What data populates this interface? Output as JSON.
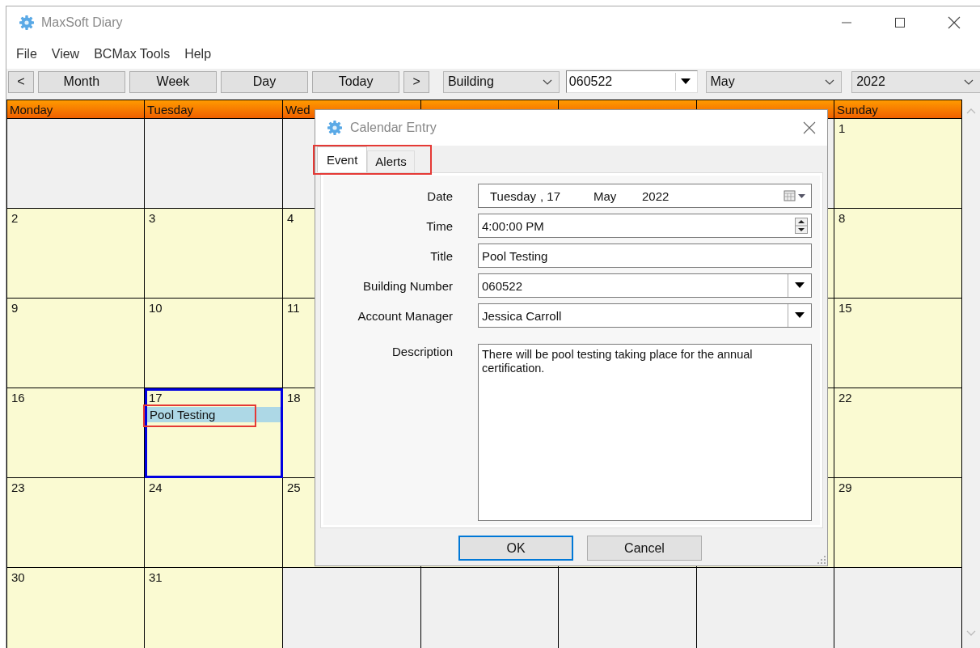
{
  "window": {
    "title": "MaxSoft Diary"
  },
  "menu": [
    "File",
    "View",
    "BCMax Tools",
    "Help"
  ],
  "toolbar": {
    "buttons": [
      {
        "label": "<",
        "kind": "narrow"
      },
      {
        "label": "Month",
        "kind": "wide"
      },
      {
        "label": "Week",
        "kind": "wide"
      },
      {
        "label": "Day",
        "kind": "wide"
      },
      {
        "label": "Today",
        "kind": "wide"
      },
      {
        "label": ">",
        "kind": "narrow"
      }
    ],
    "combos": [
      {
        "value": "Building",
        "kind": "dropdown"
      },
      {
        "value": "060522",
        "kind": "editable"
      },
      {
        "value": "May",
        "kind": "dropdown"
      },
      {
        "value": "2022",
        "kind": "dropdown"
      }
    ]
  },
  "calendar": {
    "columns": [
      {
        "label": "Monday"
      },
      {
        "label": "Tuesday"
      },
      {
        "label": "Wed"
      },
      {
        "label": "Sunday"
      }
    ],
    "weeks": [
      {
        "left": [
          {
            "in_month": false,
            "selected": false
          },
          {
            "in_month": false,
            "selected": false
          },
          {
            "in_month": false,
            "selected": false
          }
        ],
        "right": [
          {
            "in_month": false,
            "selected": false
          },
          {
            "day": "1",
            "in_month": true,
            "selected": false
          }
        ]
      },
      {
        "left": [
          {
            "day": "2",
            "in_month": true,
            "selected": false
          },
          {
            "day": "3",
            "in_month": true,
            "selected": false
          },
          {
            "day": "4",
            "in_month": true,
            "selected": false
          }
        ],
        "right": [
          {
            "in_month": true,
            "selected": false
          },
          {
            "day": "8",
            "in_month": true,
            "selected": false
          }
        ]
      },
      {
        "left": [
          {
            "day": "9",
            "in_month": true,
            "selected": false
          },
          {
            "day": "10",
            "in_month": true,
            "selected": false
          },
          {
            "day": "11",
            "in_month": true,
            "selected": false
          }
        ],
        "right": [
          {
            "in_month": true,
            "selected": false
          },
          {
            "day": "15",
            "in_month": true,
            "selected": false
          }
        ]
      },
      {
        "left": [
          {
            "day": "16",
            "in_month": true,
            "selected": false
          },
          {
            "day": "17",
            "in_month": true,
            "selected": true,
            "events": [
              {
                "title": "Pool Testing",
                "highlighted": true
              }
            ]
          },
          {
            "day": "18",
            "in_month": true,
            "selected": false
          }
        ],
        "right": [
          {
            "in_month": true,
            "selected": false
          },
          {
            "day": "22",
            "in_month": true,
            "selected": false
          }
        ]
      },
      {
        "left": [
          {
            "day": "23",
            "in_month": true,
            "selected": false
          },
          {
            "day": "24",
            "in_month": true,
            "selected": false
          },
          {
            "day": "25",
            "in_month": true,
            "selected": false
          }
        ],
        "right": [
          {
            "in_month": true,
            "selected": false
          },
          {
            "day": "29",
            "in_month": true,
            "selected": false
          }
        ]
      },
      {
        "left": [
          {
            "day": "30",
            "in_month": true,
            "selected": false
          },
          {
            "day": "31",
            "in_month": true,
            "selected": false
          },
          {
            "in_month": false,
            "selected": false
          }
        ],
        "middle": [
          {
            "in_month": false,
            "selected": false
          },
          {
            "in_month": false,
            "selected": false
          }
        ],
        "right": [
          {
            "in_month": false,
            "selected": false
          },
          {
            "in_month": false,
            "selected": false
          }
        ]
      }
    ]
  },
  "dialog": {
    "title": "Calendar Entry",
    "tabs": [
      {
        "label": "Event",
        "selected": true
      },
      {
        "label": "Alerts",
        "selected": false
      }
    ],
    "tabs_highlighted": true,
    "fields": [
      {
        "label": "Date",
        "kind": "date",
        "parts": [
          "Tuesday",
          ", 17",
          "May",
          "2022"
        ]
      },
      {
        "label": "Time",
        "kind": "time",
        "value": "4:00:00 PM"
      },
      {
        "label": "Title",
        "kind": "text",
        "value": "Pool Testing"
      },
      {
        "label": "Building Number",
        "kind": "combo",
        "value": "060522"
      },
      {
        "label": "Account Manager",
        "kind": "combo",
        "value": "Jessica Carroll"
      },
      {
        "label": "Description",
        "kind": "memo",
        "value": "There will be pool testing taking place for the annual certification."
      }
    ],
    "buttons": [
      {
        "label": "OK",
        "default": true
      },
      {
        "label": "Cancel",
        "default": false
      }
    ]
  }
}
